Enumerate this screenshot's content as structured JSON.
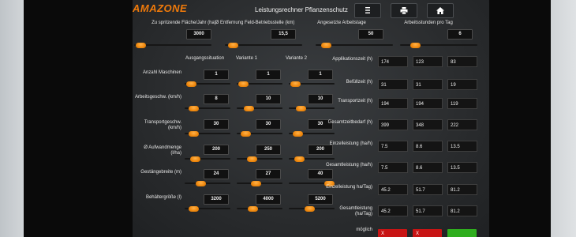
{
  "header": {
    "logo": "AMAZONE",
    "title": "Leistungsrechner Pflanzenschutz",
    "menu_icon": "menu-icon",
    "print_icon": "print-icon",
    "home_icon": "home-icon"
  },
  "top_params": [
    {
      "label": "Zu spritzende Fläche/Jahr (ha)",
      "value": "3000",
      "slider": 0.02
    },
    {
      "label": "Ø Entfernung Feld-Betriebsstelle (km)",
      "value": "15,5",
      "slider": 0.05
    },
    {
      "label": "Angesetzte Arbeitstage",
      "value": "50",
      "slider": 0.08
    },
    {
      "label": "Arbeitsstunden pro Tag",
      "value": "6",
      "slider": 0.15
    }
  ],
  "columns": [
    "Ausgangssituation",
    "Variante 1",
    "Variante 2"
  ],
  "inputs": [
    {
      "label": "Anzahl Maschinen",
      "values": [
        "1",
        "1",
        "1"
      ],
      "sliders": [
        0.05,
        0.05,
        0.05
      ]
    },
    {
      "label": "Arbeitsgeschw. (km/h)",
      "values": [
        "8",
        "10",
        "10"
      ],
      "sliders": [
        0.12,
        0.2,
        0.2
      ]
    },
    {
      "label": "Transportgeschw. (km/h)",
      "values": [
        "30",
        "30",
        "30"
      ],
      "sliders": [
        0.1,
        0.1,
        0.1
      ]
    },
    {
      "label": "Ø Aufwandmenge (l/ha)",
      "values": [
        "200",
        "250",
        "200"
      ],
      "sliders": [
        0.15,
        0.28,
        0.15
      ]
    },
    {
      "label": "Gestängebreite (m)",
      "values": [
        "24",
        "27",
        "40"
      ],
      "sliders": [
        0.3,
        0.4,
        1.0
      ]
    },
    {
      "label": "Behältergröße (l)",
      "values": [
        "3200",
        "4000",
        "5200"
      ],
      "sliders": [
        0.1,
        0.3,
        0.45
      ]
    }
  ],
  "outputs": [
    {
      "label": "Applikationszeit (h)",
      "values": [
        "174",
        "123",
        "83"
      ]
    },
    {
      "label": "Befüllzeit (h)",
      "values": [
        "31",
        "31",
        "19"
      ]
    },
    {
      "label": "Transportzeit (h)",
      "values": [
        "194",
        "194",
        "119"
      ]
    },
    {
      "label": "Gesamtzeitbedarf (h)",
      "values": [
        "399",
        "348",
        "222"
      ]
    },
    {
      "label": "Einzelleistung (ha/h)",
      "values": [
        "7.5",
        "8.6",
        "13.5"
      ]
    },
    {
      "label": "Gesamtleistung (ha/h)",
      "values": [
        "7.5",
        "8.6",
        "13.5"
      ]
    },
    {
      "label": "Einzelleistung ha/Tag)",
      "values": [
        "45.2",
        "51.7",
        "81.2"
      ]
    },
    {
      "label": "Gesamtleistung (ha/Tag)",
      "values": [
        "45.2",
        "51.7",
        "81.2"
      ]
    }
  ],
  "feasible": {
    "label": "möglich",
    "values": [
      "X",
      "X",
      ""
    ],
    "colors": [
      "#c81414",
      "#c81414",
      "#2fae1e"
    ]
  },
  "colors": {
    "accent": "#f08a10",
    "bad": "#c81414",
    "good": "#2fae1e"
  }
}
